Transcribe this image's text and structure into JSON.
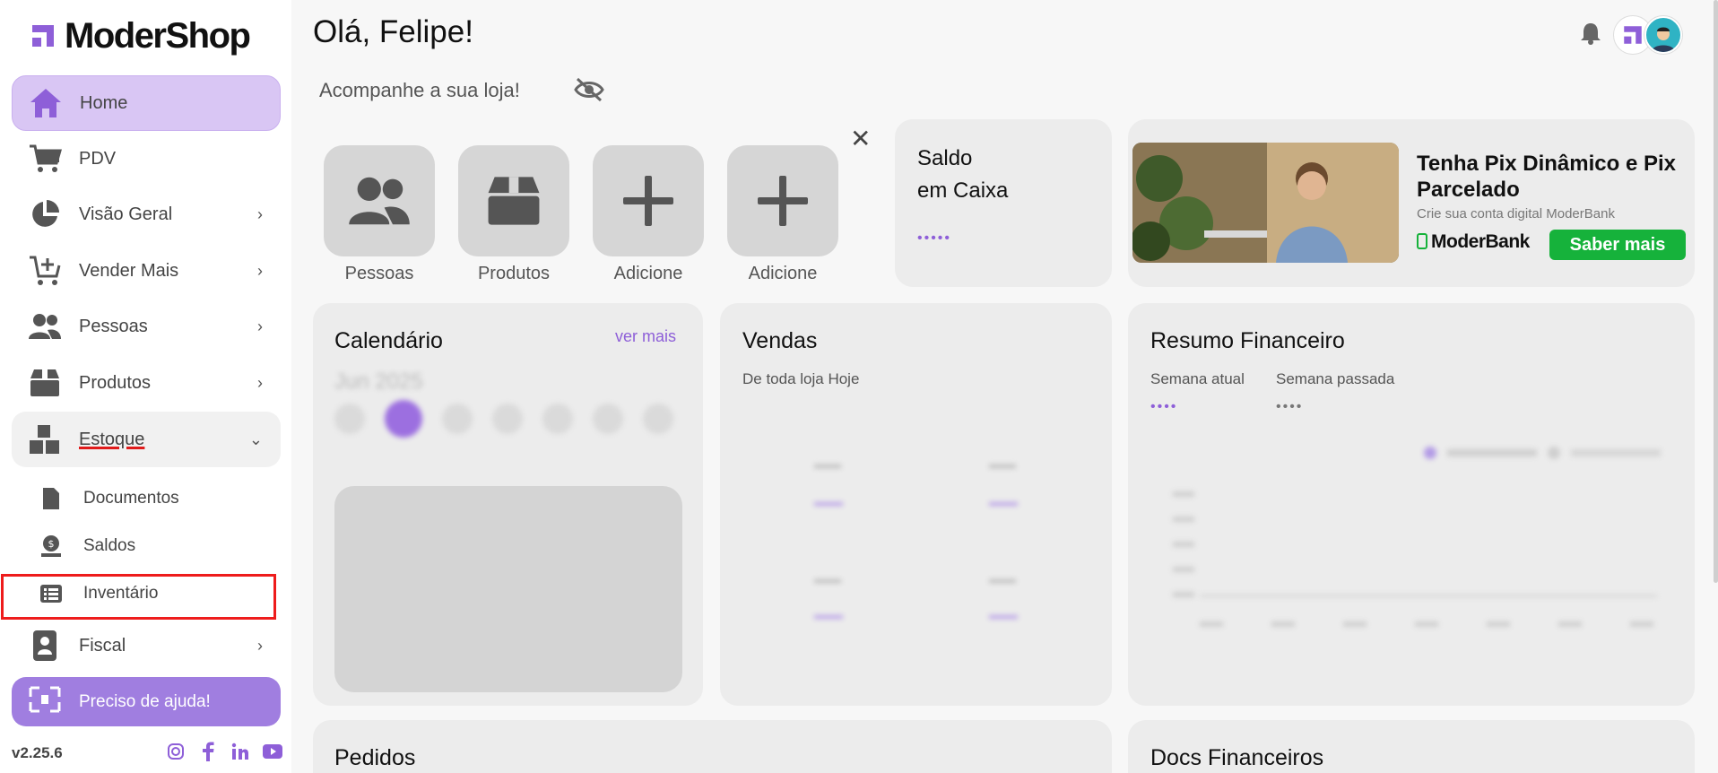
{
  "brand": {
    "name": "ModerShop",
    "accent": "#8e5fd8"
  },
  "sidebar": {
    "items": [
      {
        "label": "Home",
        "icon": "home-icon"
      },
      {
        "label": "PDV",
        "icon": "cart-icon"
      },
      {
        "label": "Visão Geral",
        "icon": "pie-chart-icon"
      },
      {
        "label": "Vender Mais",
        "icon": "cart-plus-icon"
      },
      {
        "label": "Pessoas",
        "icon": "people-icon"
      },
      {
        "label": "Produtos",
        "icon": "box-icon"
      },
      {
        "label": "Estoque",
        "icon": "boxes-icon"
      }
    ],
    "subitems": [
      {
        "label": "Documentos",
        "icon": "document-icon"
      },
      {
        "label": "Saldos",
        "icon": "money-icon"
      },
      {
        "label": "Inventário",
        "icon": "list-icon"
      }
    ],
    "fiscal": {
      "label": "Fiscal",
      "icon": "badge-icon"
    },
    "help": {
      "label": "Preciso de ajuda!",
      "icon": "help-icon"
    },
    "version": "v2.25.6",
    "socials": [
      "instagram-icon",
      "facebook-icon",
      "linkedin-icon",
      "youtube-icon"
    ]
  },
  "header": {
    "greeting": "Olá, Felipe!",
    "subtitle": "Acompanhe a sua loja!"
  },
  "shortcuts": [
    {
      "label": "Pessoas"
    },
    {
      "label": "Produtos"
    },
    {
      "label": "Adicione"
    },
    {
      "label": "Adicione"
    }
  ],
  "saldo": {
    "title_line1": "Saldo",
    "title_line2": "em Caixa",
    "value": "•••••"
  },
  "banner": {
    "title": "Tenha Pix Dinâmico e Pix Parcelado",
    "subtitle": "Crie sua conta digital ModerBank",
    "brand": "ModerBank",
    "button": "Saber mais"
  },
  "calendar": {
    "title": "Calendário",
    "link": "ver mais",
    "month": "Jun 2025"
  },
  "vendas": {
    "title": "Vendas",
    "subtitle": "De toda loja Hoje"
  },
  "resumo": {
    "title": "Resumo Financeiro",
    "current_label": "Semana atual",
    "previous_label": "Semana passada",
    "current_value": "••••",
    "previous_value": "••••"
  },
  "pedidos": {
    "title": "Pedidos"
  },
  "docs": {
    "title": "Docs Financeiros"
  },
  "colors": {
    "sidebar_active": "#d9c6f4",
    "card": "#ececec",
    "button_green": "#16b23b",
    "highlight_red": "#ee1c1c"
  }
}
